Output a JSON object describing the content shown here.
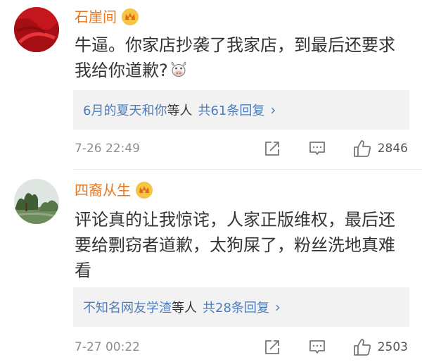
{
  "comments": [
    {
      "username": "石崖间",
      "text": "牛逼。你家店抄袭了我家店，到最后还要求我给你道歉?",
      "emoji": "cow-face-emoji",
      "reply_users": "6月的夏天和你",
      "reply_suffix": "等人",
      "reply_count": "共61条回复",
      "timestamp": "7-26 22:49",
      "likes": "2846"
    },
    {
      "username": "四裔从生",
      "text": "评论真的让我惊诧，人家正版维权，最后还要给剽窃者道歉，太狗屎了，粉丝洗地真难看",
      "reply_users": "不知名网友学渣",
      "reply_suffix": "等人",
      "reply_count": "共28条回复",
      "timestamp": "7-27 00:22",
      "likes": "2503"
    }
  ],
  "icons": {
    "chevron": "›",
    "badge": "vip-crown-badge-icon",
    "share": "share-icon",
    "reply": "reply-icon",
    "like": "thumbs-up-icon"
  },
  "colors": {
    "username": "#e8751a",
    "link": "#4d7dbd",
    "meta": "#8f8f8f",
    "reply_bg": "#f2f2f2"
  }
}
